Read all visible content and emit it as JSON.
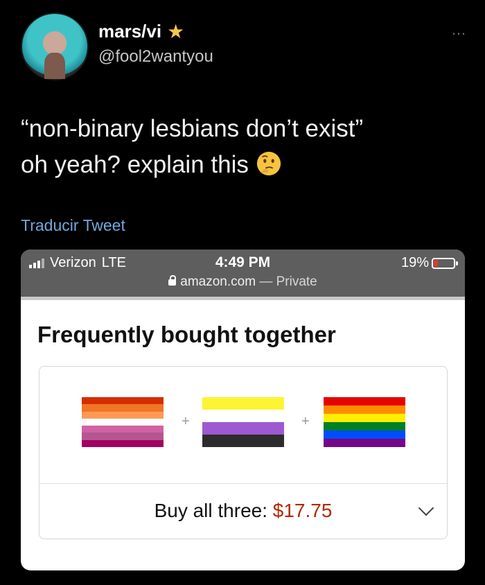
{
  "tweet": {
    "display_name": "mars/vi",
    "handle": "@fool2wantyou",
    "more_icon": "…",
    "text_line1": "“non-binary lesbians don’t exist”",
    "text_line2": "oh yeah? explain this",
    "emoji": "thinking-face",
    "translate_label": "Traducir Tweet",
    "colors": {
      "translate": "#6fa8dc",
      "star": "#f3c64c"
    }
  },
  "screenshot": {
    "status_bar": {
      "carrier": "Verizon",
      "network": "LTE",
      "time": "4:49 PM",
      "battery": "19%",
      "battery_level": 0.19,
      "url": "amazon.com",
      "url_suffix": "— Private"
    },
    "section_title": "Frequently bought together",
    "products": [
      {
        "name": "lesbian-flag",
        "colors": [
          "#d52d00",
          "#ef7627",
          "#ff9a56",
          "#ffffff",
          "#d162a4",
          "#b55690",
          "#a30262"
        ]
      },
      {
        "name": "nonbinary-flag",
        "colors": [
          "#fcf434",
          "#ffffff",
          "#9c59d1",
          "#2c2c2c"
        ]
      },
      {
        "name": "rainbow-flag",
        "colors": [
          "#e40303",
          "#ff8c00",
          "#ffed00",
          "#008026",
          "#004dff",
          "#750787"
        ]
      }
    ],
    "plus_symbol": "+",
    "buy_label": "Buy all three: ",
    "buy_price": "$17.75"
  }
}
